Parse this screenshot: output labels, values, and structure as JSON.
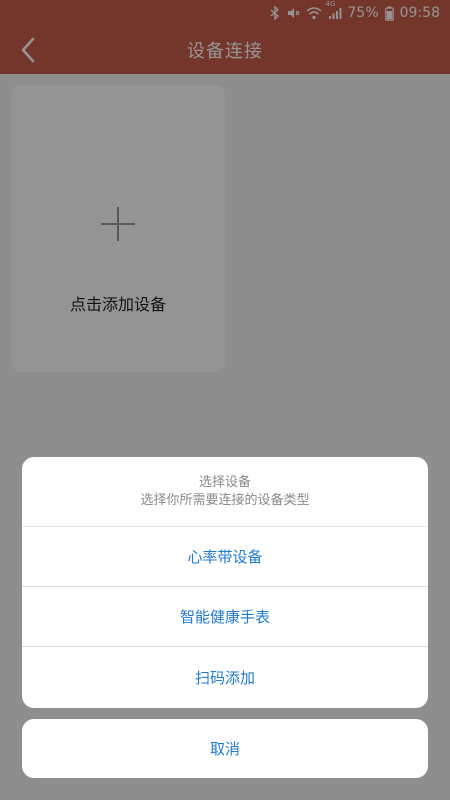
{
  "status_bar": {
    "battery_percent": "75%",
    "time": "09:58",
    "network_label": "4G",
    "icons": [
      "bluetooth-icon",
      "mute-icon",
      "wifi-icon",
      "signal-icon",
      "battery-icon"
    ]
  },
  "header": {
    "title": "设备连接",
    "back_icon": "chevron-left-icon"
  },
  "main": {
    "add_device_label": "点击添加设备",
    "add_icon": "plus-icon"
  },
  "action_sheet": {
    "title": "选择设备",
    "subtitle": "选择你所需要连接的设备类型",
    "options": [
      {
        "label": "心率带设备"
      },
      {
        "label": "智能健康手表"
      },
      {
        "label": "扫码添加"
      }
    ],
    "cancel_label": "取消"
  },
  "colors": {
    "brand": "#c85d4a",
    "link": "#1f7ad1",
    "background": "#f4f4f4"
  }
}
